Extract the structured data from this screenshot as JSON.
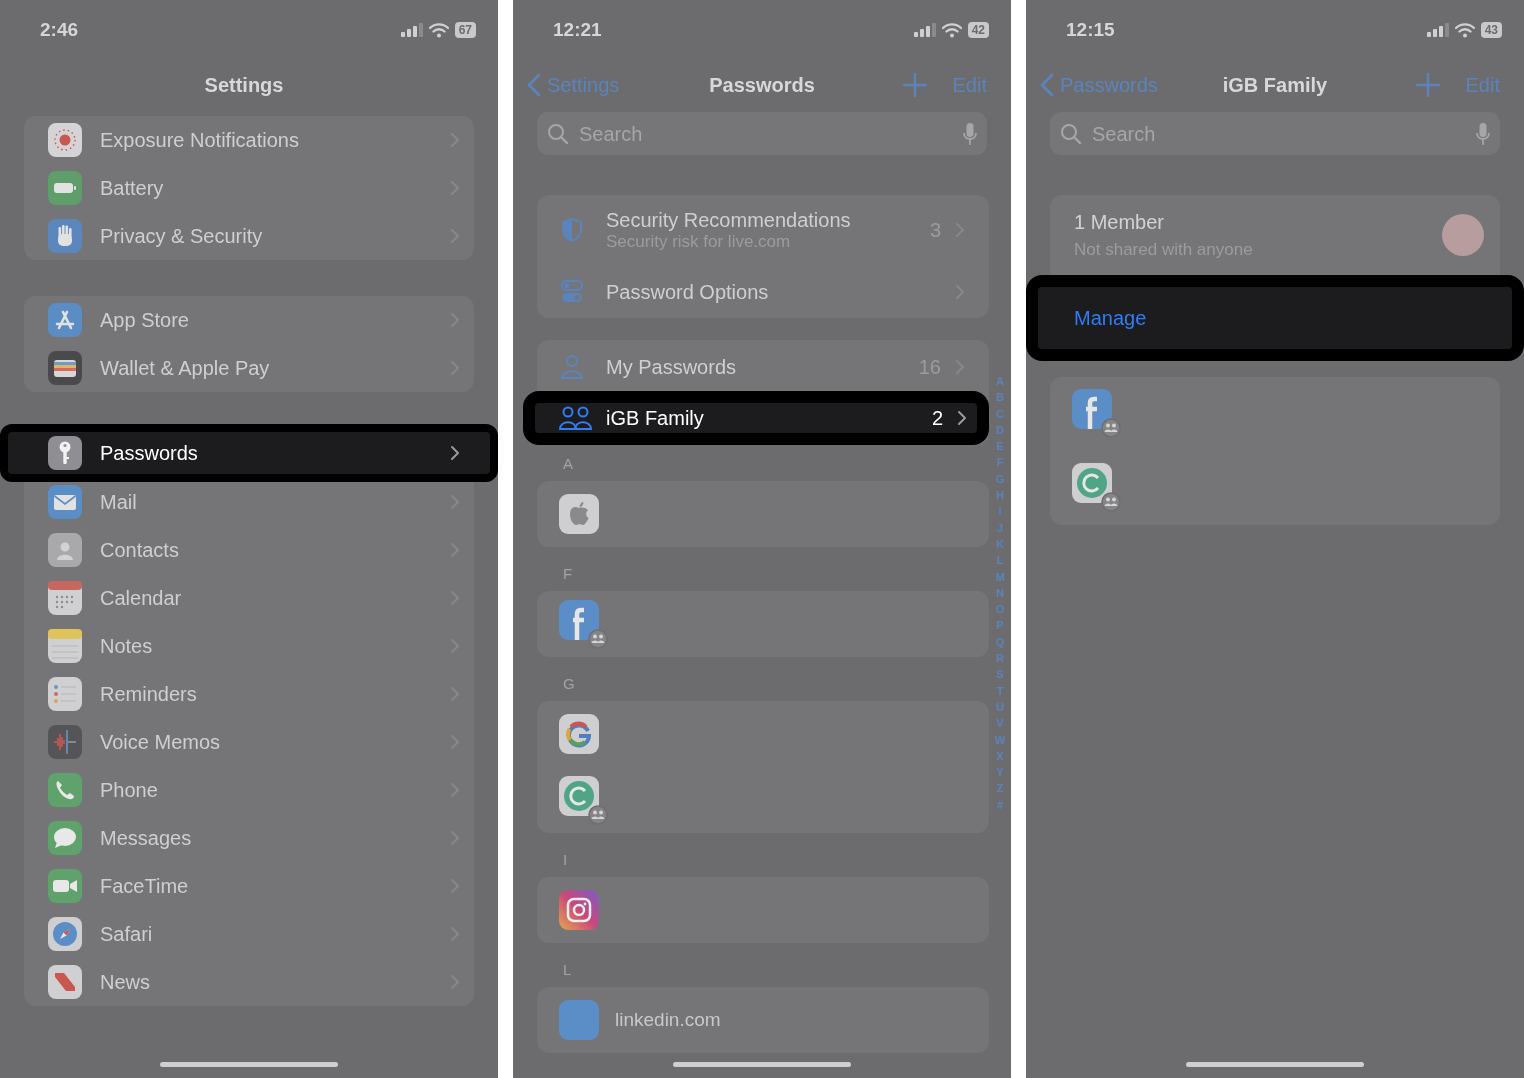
{
  "screens": [
    {
      "kind": "settings",
      "status": {
        "time": "2:46",
        "battery": "67"
      },
      "title": "Settings",
      "groups": [
        {
          "items": [
            {
              "label": "Exposure Notifications",
              "color": "#d4d4d6",
              "selected": false
            },
            {
              "label": "Battery",
              "color": "#5f9e6b",
              "selected": false
            },
            {
              "label": "Privacy & Security",
              "color": "#5b87bd",
              "selected": false
            }
          ]
        },
        {
          "items": [
            {
              "label": "App Store",
              "color": "#5b8dc4",
              "selected": false
            },
            {
              "label": "Wallet & Apple Pay",
              "color": "#4a4a4c",
              "selected": false
            }
          ]
        },
        {
          "items": [
            {
              "label": "Passwords",
              "color": "#8e8e93",
              "selected": true
            },
            {
              "label": "Mail",
              "color": "#5b8ec6",
              "selected": false
            },
            {
              "label": "Contacts",
              "color": "#a9a9ab",
              "selected": false
            },
            {
              "label": "Calendar",
              "color": "#d0d0d2",
              "selected": false
            },
            {
              "label": "Notes",
              "color": "#d0d0d2",
              "selected": false
            },
            {
              "label": "Reminders",
              "color": "#d0d0d2",
              "selected": false
            },
            {
              "label": "Voice Memos",
              "color": "#555557",
              "selected": false
            },
            {
              "label": "Phone",
              "color": "#5fa26c",
              "selected": false
            },
            {
              "label": "Messages",
              "color": "#5fa26c",
              "selected": false
            },
            {
              "label": "FaceTime",
              "color": "#5fa26c",
              "selected": false
            },
            {
              "label": "Safari",
              "color": "#cfcfd1",
              "selected": false
            },
            {
              "label": "News",
              "color": "#d0d0d2",
              "selected": false
            }
          ]
        }
      ]
    },
    {
      "kind": "passwords",
      "status": {
        "time": "12:21",
        "battery": "42"
      },
      "back": "Settings",
      "title": "Passwords",
      "edit": "Edit",
      "search": {
        "placeholder": "Search"
      },
      "groups": [
        {
          "items": [
            {
              "label": "Security Recommendations",
              "subtitle": "Security risk for live.com",
              "count": "3",
              "selected": false
            },
            {
              "label": "Password Options",
              "selected": false
            }
          ]
        },
        {
          "items": [
            {
              "label": "My Passwords",
              "count": "16",
              "selected": false
            },
            {
              "label": "iGB Family",
              "count": "2",
              "selected": true
            }
          ]
        }
      ],
      "sections": [
        {
          "letter": "A",
          "sites": [
            {
              "shared": false
            }
          ]
        },
        {
          "letter": "F",
          "sites": [
            {
              "shared": true
            }
          ]
        },
        {
          "letter": "G",
          "sites": [
            {
              "shared": false
            },
            {
              "shared": true
            }
          ]
        },
        {
          "letter": "I",
          "sites": [
            {
              "shared": false
            }
          ]
        },
        {
          "letter": "L",
          "sites": [
            {
              "label": "linkedin.com",
              "shared": false
            }
          ]
        }
      ],
      "index": [
        "A",
        "B",
        "C",
        "D",
        "E",
        "F",
        "G",
        "H",
        "I",
        "J",
        "K",
        "L",
        "M",
        "N",
        "O",
        "P",
        "Q",
        "R",
        "S",
        "T",
        "U",
        "V",
        "W",
        "X",
        "Y",
        "Z",
        "#"
      ]
    },
    {
      "kind": "group",
      "status": {
        "time": "12:15",
        "battery": "43"
      },
      "back": "Passwords",
      "title": "iGB Family",
      "edit": "Edit",
      "search": {
        "placeholder": "Search"
      },
      "members": {
        "title": "1 Member",
        "subtitle": "Not shared with anyone"
      },
      "manage": {
        "label": "Manage",
        "selected": true
      },
      "sites": [
        {
          "shared": true
        },
        {
          "shared": true
        }
      ]
    }
  ]
}
